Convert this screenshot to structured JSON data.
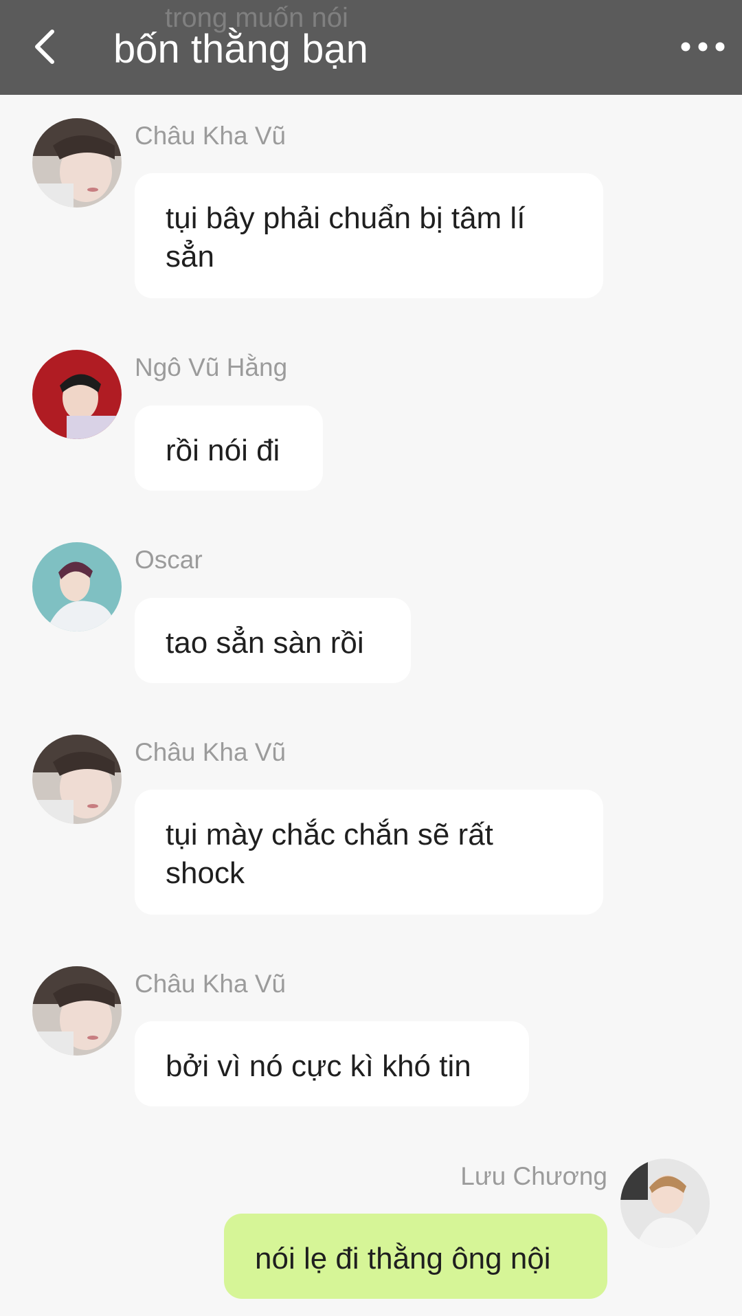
{
  "header": {
    "ghost_text": "trong muốn nói",
    "title": "bốn thằng bạn"
  },
  "messages": [
    {
      "sender": "Châu Kha Vũ",
      "text": "tụi bây phải chuẩn bị tâm lí sẳn",
      "avatar": "avatar-chau-kha-vu"
    },
    {
      "sender": "Ngô Vũ Hằng",
      "text": "rồi nói đi",
      "avatar": "avatar-ngo-vu-hang"
    },
    {
      "sender": "Oscar",
      "text": "tao sẳn sàn rồi",
      "avatar": "avatar-oscar"
    },
    {
      "sender": "Châu Kha Vũ",
      "text": "tụi mày chắc chắn sẽ rất shock",
      "avatar": "avatar-chau-kha-vu"
    },
    {
      "sender": "Châu Kha Vũ",
      "text": "bởi vì nó cực kì khó tin",
      "avatar": "avatar-chau-kha-vu"
    },
    {
      "sender": "Lưu Chương",
      "text": "nói lẹ đi thằng ông nội",
      "avatar": "avatar-luu-chuong",
      "self": true
    }
  ],
  "colors": {
    "header_bg": "#5b5b5b",
    "chat_bg": "#f7f7f7",
    "bubble_other": "#ffffff",
    "bubble_self": "#d6f597",
    "name_text": "#9b9b9b"
  },
  "icons": {
    "back": "chevron-left-icon",
    "more": "more-horizontal-icon"
  }
}
